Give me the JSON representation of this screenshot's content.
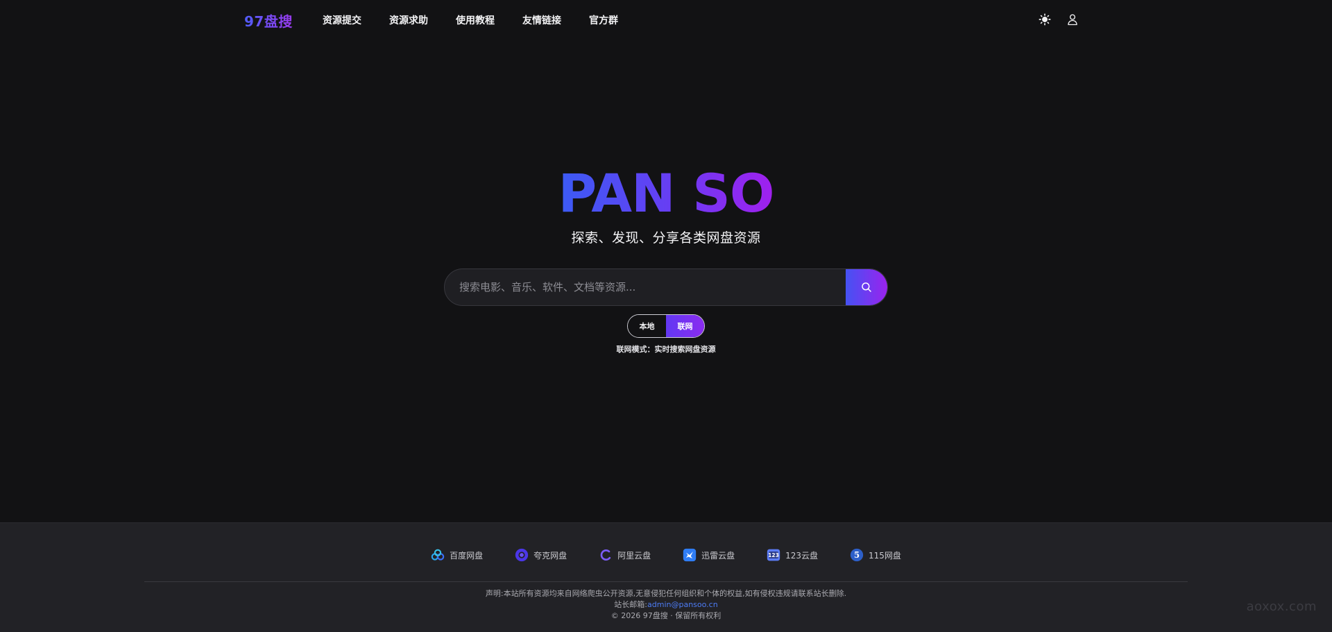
{
  "header": {
    "logo": "97盘搜",
    "nav": [
      "资源提交",
      "资源求助",
      "使用教程",
      "友情链接",
      "官方群"
    ],
    "icons": [
      "sun-icon",
      "user-icon"
    ]
  },
  "hero": {
    "title": "PAN SO",
    "subtitle": "探索、发现、分享各类网盘资源"
  },
  "search": {
    "placeholder": "搜索电影、音乐、软件、文档等资源...",
    "button_icon": "search-icon"
  },
  "mode": {
    "local": "本地",
    "online": "联网",
    "selected": "联网",
    "hint": "联网模式：实时搜索网盘资源"
  },
  "footer": {
    "drives": [
      {
        "label": "百度网盘",
        "icon": "baidu-pan-icon"
      },
      {
        "label": "夸克网盘",
        "icon": "quark-pan-icon"
      },
      {
        "label": "阿里云盘",
        "icon": "aliyun-pan-icon"
      },
      {
        "label": "迅雷云盘",
        "icon": "xunlei-pan-icon"
      },
      {
        "label": "123云盘",
        "icon": "123-pan-icon"
      },
      {
        "label": "115网盘",
        "icon": "115-pan-icon"
      }
    ],
    "disclaimer": "声明:本站所有资源均来自网络爬虫公开资源,无意侵犯任何组织和个体的权益,如有侵权违规请联系站长删除.",
    "email_label": "站长邮箱:",
    "email": "admin@pansoo.cn",
    "copyright": "© 2026 97盘搜 · 保留所有权利"
  },
  "watermark": "aoxox.com",
  "colors": {
    "background": "#121214",
    "footer": "#222226",
    "accent_start": "#3b5bf5",
    "accent_end": "#a020ee",
    "link": "#4d7cf5"
  }
}
